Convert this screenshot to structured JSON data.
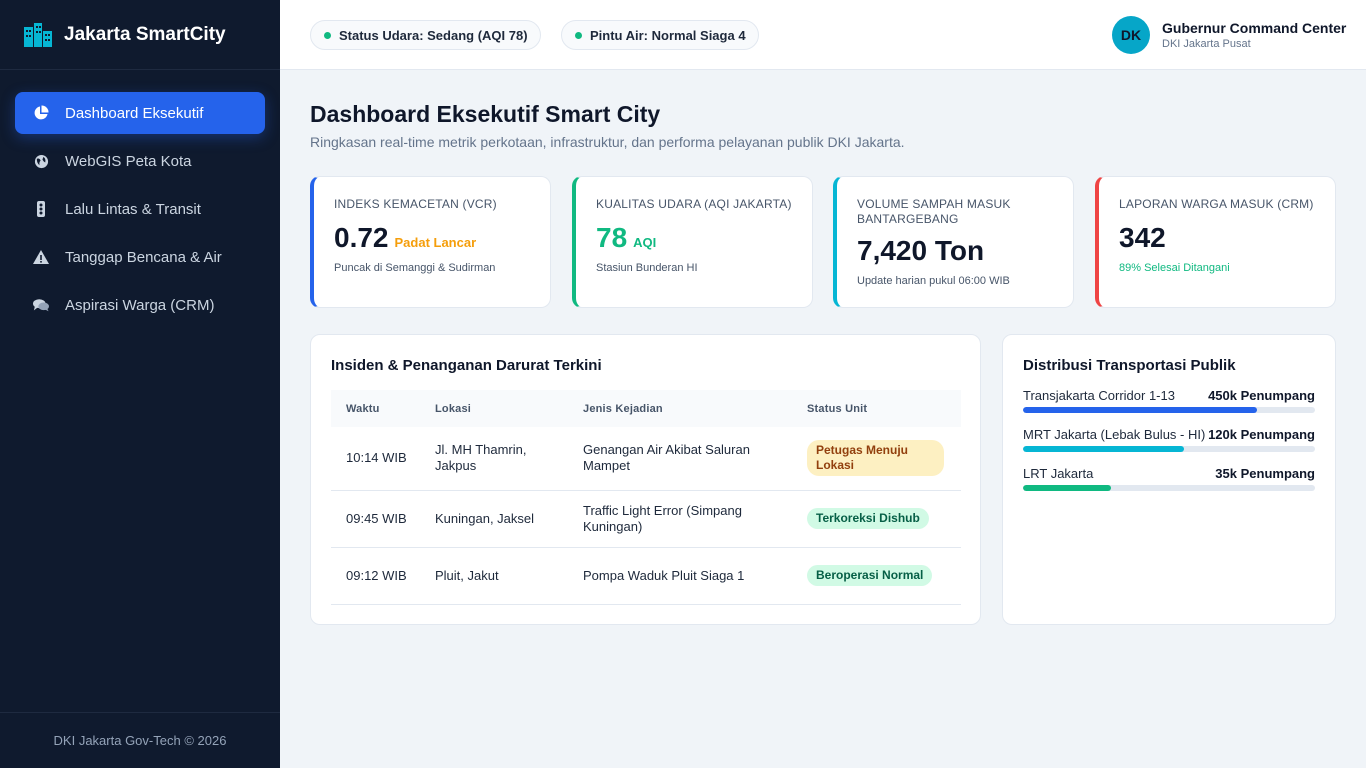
{
  "app": {
    "title": "Jakarta SmartCity",
    "footer": "DKI Jakarta Gov-Tech © 2026"
  },
  "sidebar": {
    "items": [
      {
        "label": "Dashboard Eksekutif",
        "icon": "pie-chart-icon",
        "active": true
      },
      {
        "label": "WebGIS Peta Kota",
        "icon": "globe-icon",
        "active": false
      },
      {
        "label": "Lalu Lintas & Transit",
        "icon": "traffic-light-icon",
        "active": false
      },
      {
        "label": "Tanggap Bencana & Air",
        "icon": "warning-icon",
        "active": false
      },
      {
        "label": "Aspirasi Warga (CRM)",
        "icon": "chat-bubbles-icon",
        "active": false
      }
    ]
  },
  "topbar": {
    "status_air": "Status Udara: Sedang (AQI 78)",
    "status_water": "Pintu Air: Normal Siaga 4",
    "user": {
      "initials": "DK",
      "name": "Gubernur Command Center",
      "sub": "DKI Jakarta Pusat"
    }
  },
  "page": {
    "title": "Dashboard Eksekutif Smart City",
    "subtitle": "Ringkasan real-time metrik perkotaan, infrastruktur, dan performa pelayanan publik DKI Jakarta."
  },
  "kpis": [
    {
      "label": "Indeks Kemacetan (VCR)",
      "value": "0.72",
      "unit": "Padat Lancar",
      "foot": "Puncak di Semanggi & Sudirman",
      "accent": "#2563eb"
    },
    {
      "label": "Kualitas Udara (AQI Jakarta)",
      "value": "78",
      "unit": "AQI",
      "foot": "Stasiun Bunderan HI",
      "accent": "#10b981"
    },
    {
      "label": "Volume Sampah Masuk Bantargebang",
      "value": "7,420 Ton",
      "unit": "",
      "foot": "Update harian pukul 06:00 WIB",
      "accent": "#06b6d4"
    },
    {
      "label": "Laporan Warga Masuk (CRM)",
      "value": "342",
      "unit": "",
      "foot": "89% Selesai Ditangani",
      "accent": "#ef4444"
    }
  ],
  "incidents": {
    "title": "Insiden & Penanganan Darurat Terkini",
    "columns": [
      "Waktu",
      "Lokasi",
      "Jenis Kejadian",
      "Status Unit"
    ],
    "rows": [
      {
        "time": "10:14 WIB",
        "location": "Jl. MH Thamrin, Jakpus",
        "type": "Genangan Air Akibat Saluran Mampet",
        "status": "Petugas Menuju Lokasi"
      },
      {
        "time": "09:45 WIB",
        "location": "Kuningan, Jaksel",
        "type": "Traffic Light Error (Simpang Kuningan)",
        "status": "Terkoreksi Dishub"
      },
      {
        "time": "09:12 WIB",
        "location": "Pluit, Jakut",
        "type": "Pompa Waduk Pluit Siaga 1",
        "status": "Beroperasi Normal"
      }
    ]
  },
  "transport": {
    "title": "Distribusi Transportasi Publik",
    "items": [
      {
        "name": "Transjakarta Corridor 1-13",
        "value": "450k Penumpang",
        "share": 0.8,
        "color": "#2563eb"
      },
      {
        "name": "MRT Jakarta (Lebak Bulus - HI)",
        "value": "120k Penumpang",
        "share": 0.55,
        "color": "#06b6d4"
      },
      {
        "name": "LRT Jakarta",
        "value": "35k Penumpang",
        "share": 0.3,
        "color": "#10b981"
      }
    ]
  },
  "colors": {
    "sidebar_bg": "#0f1a2e",
    "primary": "#2563eb",
    "success": "#10b981",
    "danger": "#ef4444",
    "cyan": "#06b6d4",
    "warning": "#f59e0b"
  }
}
